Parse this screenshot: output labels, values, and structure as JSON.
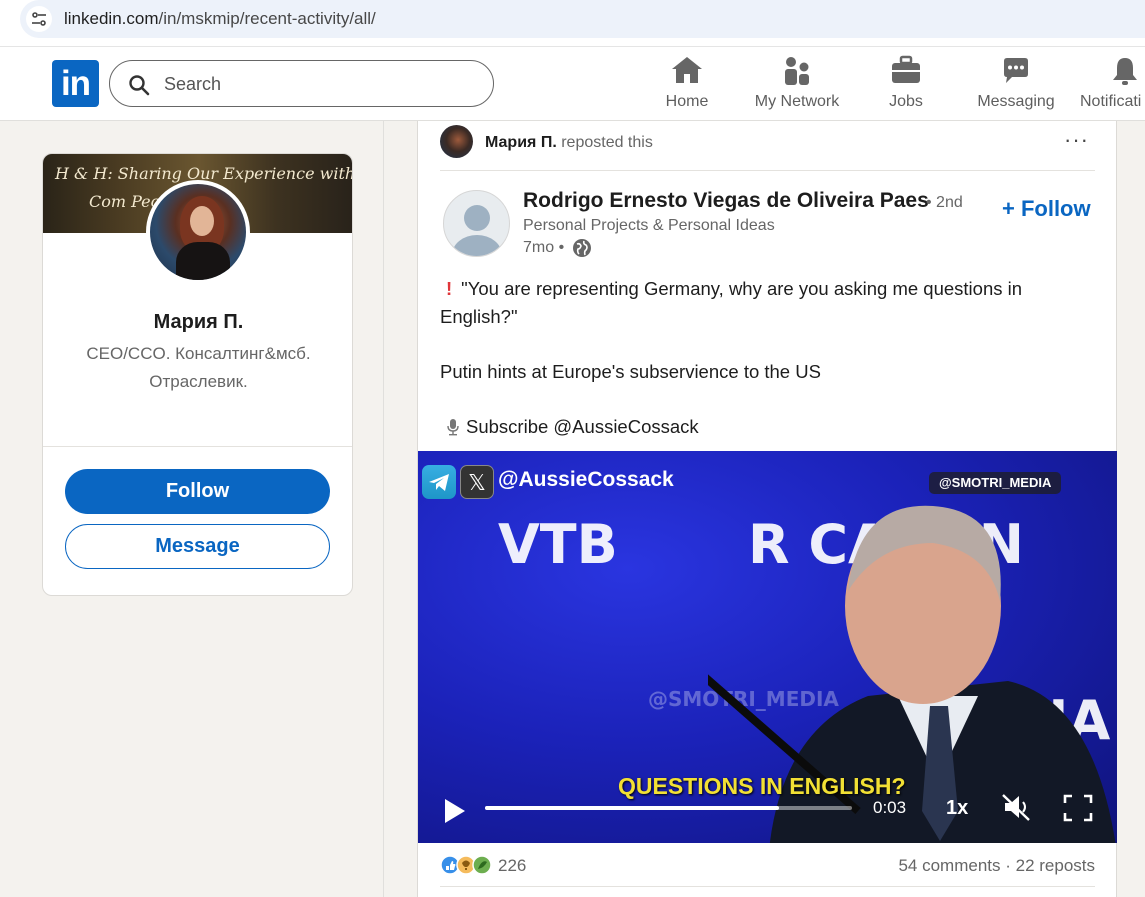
{
  "browser": {
    "url_host": "linkedin.com",
    "url_path": "/in/mskmip/recent-activity/all/"
  },
  "nav": {
    "logo": "in",
    "search_placeholder": "Search",
    "items": [
      {
        "label": "Home",
        "icon": "home-icon"
      },
      {
        "label": "My Network",
        "icon": "network-icon"
      },
      {
        "label": "Jobs",
        "icon": "briefcase-icon"
      },
      {
        "label": "Messaging",
        "icon": "messaging-icon"
      },
      {
        "label": "Notificati",
        "icon": "bell-icon"
      }
    ]
  },
  "profile": {
    "cover_line1": "H & H: Sharing Our Experience with",
    "cover_line2": "Com            People",
    "name": "Мария П.",
    "headline": "CEO/CCO. Консалтинг&мсб. Отраслевик.",
    "follow_label": "Follow",
    "message_label": "Message"
  },
  "post": {
    "reposter_name": "Мария П.",
    "repost_suffix": "reposted this",
    "more_label": "···",
    "author_name": "Rodrigo Ernesto Viegas de Oliveira Paes",
    "author_degree": "• 2nd",
    "author_subtitle": "Personal Projects & Personal Ideas",
    "author_time": "7mo •",
    "follow_label": "+ Follow",
    "body_line1": "\"You are representing Germany, why are you asking me questions in English?\"",
    "body_line2": "Putin hints at Europe's subservience to the US",
    "body_line3": "Subscribe @AussieCossack",
    "video": {
      "handle": "@AussieCossack",
      "watermark": "@SMOTRI_MEDIA",
      "bg_word1": "VTB",
      "bg_word2": "R     CALLIN",
      "bg_word3": "@SMOTRI_MEDIA",
      "bg_word4": "SSIA",
      "caption": "QUESTIONS IN ENGLISH?",
      "time": "0:03",
      "speed": "1x",
      "progress": 0.8,
      "accent": "#1a1fb4"
    },
    "reaction_count": "226",
    "comments_reposts": "54 comments · 22 reposts"
  },
  "colors": {
    "brand": "#0a66c2",
    "page_bg": "#f4f2ee"
  }
}
